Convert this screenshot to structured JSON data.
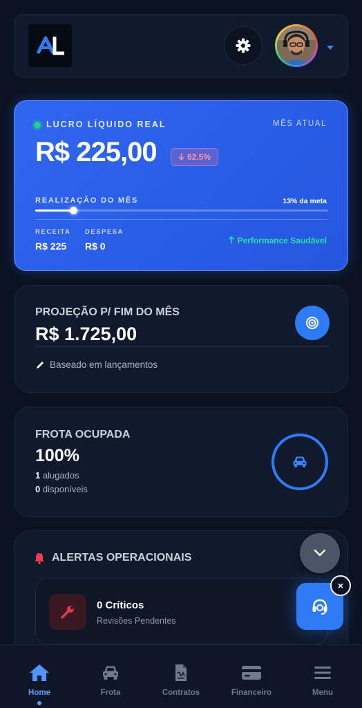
{
  "header": {
    "logo_text": "AL",
    "settings_icon": "gear-icon",
    "avatar_icon": "user-avatar",
    "menu_icon": "caret-down-icon"
  },
  "profit_card": {
    "title": "LUCRO LÍQUIDO REAL",
    "period": "MÊS ATUAL",
    "value": "R$ 225,00",
    "delta": "62.5%",
    "goal_label": "REALIZAÇÃO DO MÊS",
    "goal_pct_text": "13% da meta",
    "goal_progress": 0.13,
    "revenue_label": "RECEITA",
    "revenue_value": "R$ 225",
    "expense_label": "DESPESA",
    "expense_value": "R$ 0",
    "health_text": "Performance Saudável",
    "colors": {
      "accent": "#2f66f0",
      "positive": "#28e0a4",
      "negative": "#ff8fa0"
    }
  },
  "projection_card": {
    "title": "PROJEÇÃO P/ FIM DO MÊS",
    "value": "R$ 1.725,00",
    "note": "Baseado em lançamentos",
    "icon": "target-icon"
  },
  "fleet_card": {
    "title": "FROTA OCUPADA",
    "value": "100%",
    "rented_count": "1",
    "rented_label": "alugados",
    "available_count": "0",
    "available_label": "disponíveis",
    "icon": "car-icon"
  },
  "alerts_card": {
    "title": "ALERTAS OPERACIONAIS",
    "item_count": "0 Críticos",
    "item_sub": "Revisões Pendentes",
    "icon": "bell-icon"
  },
  "floating": {
    "scroll_icon": "chevron-down-icon",
    "support_icon": "headset-icon",
    "close_label": "×"
  },
  "bottom_nav": {
    "items": [
      {
        "label": "Home",
        "icon": "home-icon",
        "active": true
      },
      {
        "label": "Frota",
        "icon": "car-icon",
        "active": false
      },
      {
        "label": "Contratos",
        "icon": "document-icon",
        "active": false
      },
      {
        "label": "Financeiro",
        "icon": "credit-card-icon",
        "active": false
      },
      {
        "label": "Menu",
        "icon": "menu-icon",
        "active": false
      }
    ]
  }
}
